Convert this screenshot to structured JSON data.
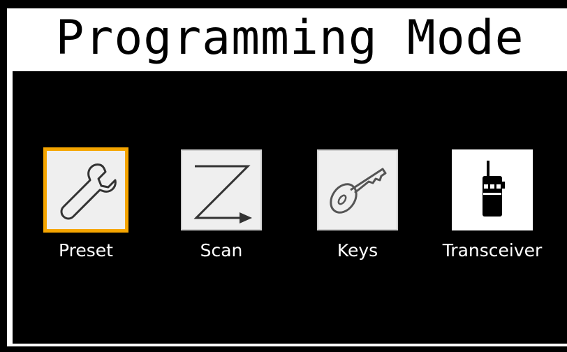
{
  "title": "Programming Mode",
  "selected_color": "#f5a500",
  "menu": {
    "items": [
      {
        "label": "Preset",
        "icon": "wrench-icon",
        "selected": true
      },
      {
        "label": "Scan",
        "icon": "scan-path-icon",
        "selected": false
      },
      {
        "label": "Keys",
        "icon": "key-icon",
        "selected": false
      },
      {
        "label": "Transceiver",
        "icon": "radio-transceiver-icon",
        "selected": false
      }
    ]
  }
}
